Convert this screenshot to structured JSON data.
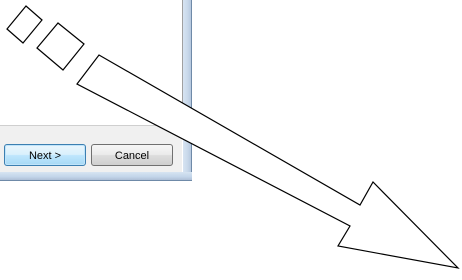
{
  "wizard": {
    "next_label": "Next >",
    "cancel_label": "Cancel"
  },
  "annotation": {
    "icon": "arrow-pointer-icon",
    "stroke_color": "#000000",
    "fill_color": "#ffffff"
  }
}
